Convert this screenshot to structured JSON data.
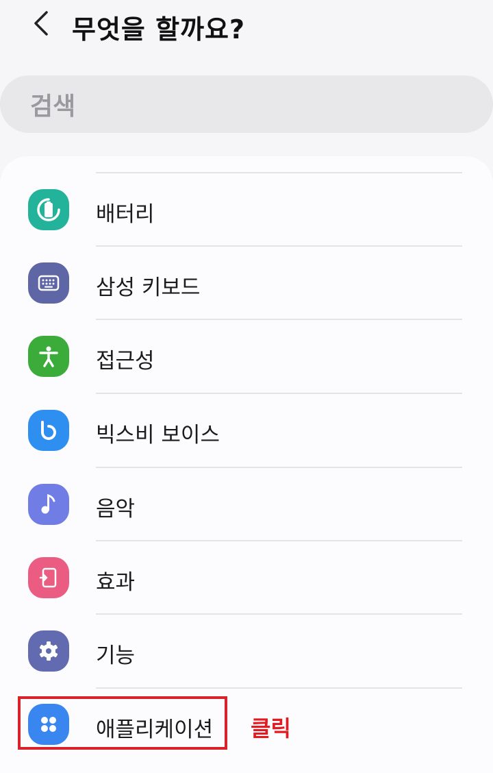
{
  "header": {
    "title": "무엇을 할까요?"
  },
  "search": {
    "placeholder": "검색"
  },
  "items": [
    {
      "label": "배터리",
      "icon": "battery-icon",
      "color": "#23b39a"
    },
    {
      "label": "삼성 키보드",
      "icon": "keyboard-icon",
      "color": "#5f66a6"
    },
    {
      "label": "접근성",
      "icon": "accessibility-icon",
      "color": "#3bab3a"
    },
    {
      "label": "빅스비 보이스",
      "icon": "bixby-icon",
      "color": "#2e8ff0"
    },
    {
      "label": "음악",
      "icon": "music-note-icon",
      "color": "#6f7de4"
    },
    {
      "label": "효과",
      "icon": "effects-icon",
      "color": "#ea5c82"
    },
    {
      "label": "기능",
      "icon": "gear-icon",
      "color": "#636bb0"
    },
    {
      "label": "애플리케이션",
      "icon": "apps-icon",
      "color": "#3a86f0"
    }
  ],
  "annotation": {
    "text": "클릭",
    "color": "#e21b22"
  }
}
